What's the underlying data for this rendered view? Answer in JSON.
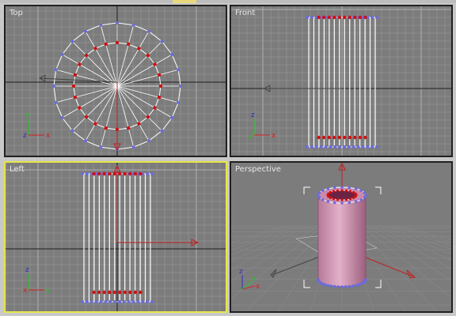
{
  "viewports": {
    "top": {
      "label": "Top"
    },
    "front": {
      "label": "Front"
    },
    "left": {
      "label": "Left"
    },
    "perspective": {
      "label": "Perspective"
    }
  },
  "active_viewport": "left",
  "colors": {
    "viewport_bg": "#7c7c7c",
    "grid_minor": "#9a9a9a",
    "grid_major": "#b0b0b0",
    "axis_line": "#1e1e1e",
    "mesh_edge": "#ffffff",
    "vertex_inner": "#d01010",
    "vertex_outer": "#6b6bdc",
    "gizmo": "#c02020",
    "active_border": "#e6e64a",
    "tube_body": "#d79ab8"
  },
  "axis_tripod": {
    "x_label": "x",
    "y_label": "y",
    "z_label": "z"
  }
}
